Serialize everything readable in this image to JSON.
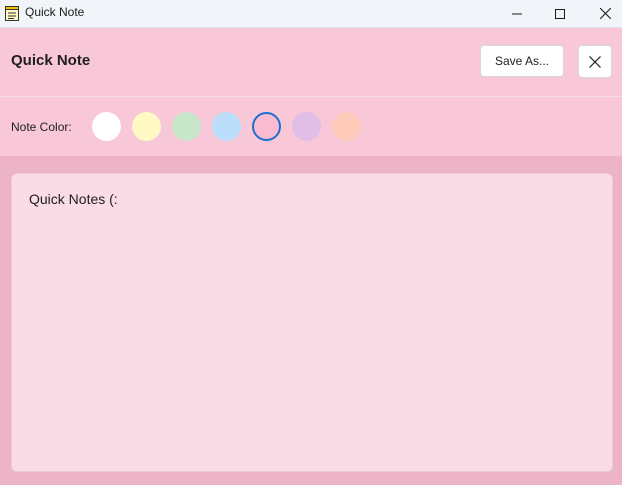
{
  "window": {
    "title": "Quick Note"
  },
  "header": {
    "heading": "Quick Note",
    "save_label": "Save As..."
  },
  "color_picker": {
    "label": "Note Color:",
    "swatches": [
      {
        "name": "white",
        "color": "#ffffff",
        "selected": false
      },
      {
        "name": "yellow",
        "color": "#fff9c4",
        "selected": false
      },
      {
        "name": "green",
        "color": "#c8e6c9",
        "selected": false
      },
      {
        "name": "blue",
        "color": "#bbdefb",
        "selected": false
      },
      {
        "name": "pink",
        "color": "#f8bbd0",
        "selected": true
      },
      {
        "name": "purple",
        "color": "#e1bee7",
        "selected": false
      },
      {
        "name": "orange",
        "color": "#ffccbc",
        "selected": false
      }
    ]
  },
  "note": {
    "content": "Quick Notes (:"
  },
  "colors": {
    "header_bg": "#f8c8d8",
    "body_bg": "#ecb4c6",
    "note_bg": "#f9dce6",
    "selected_ring": "#1f6fd1"
  }
}
